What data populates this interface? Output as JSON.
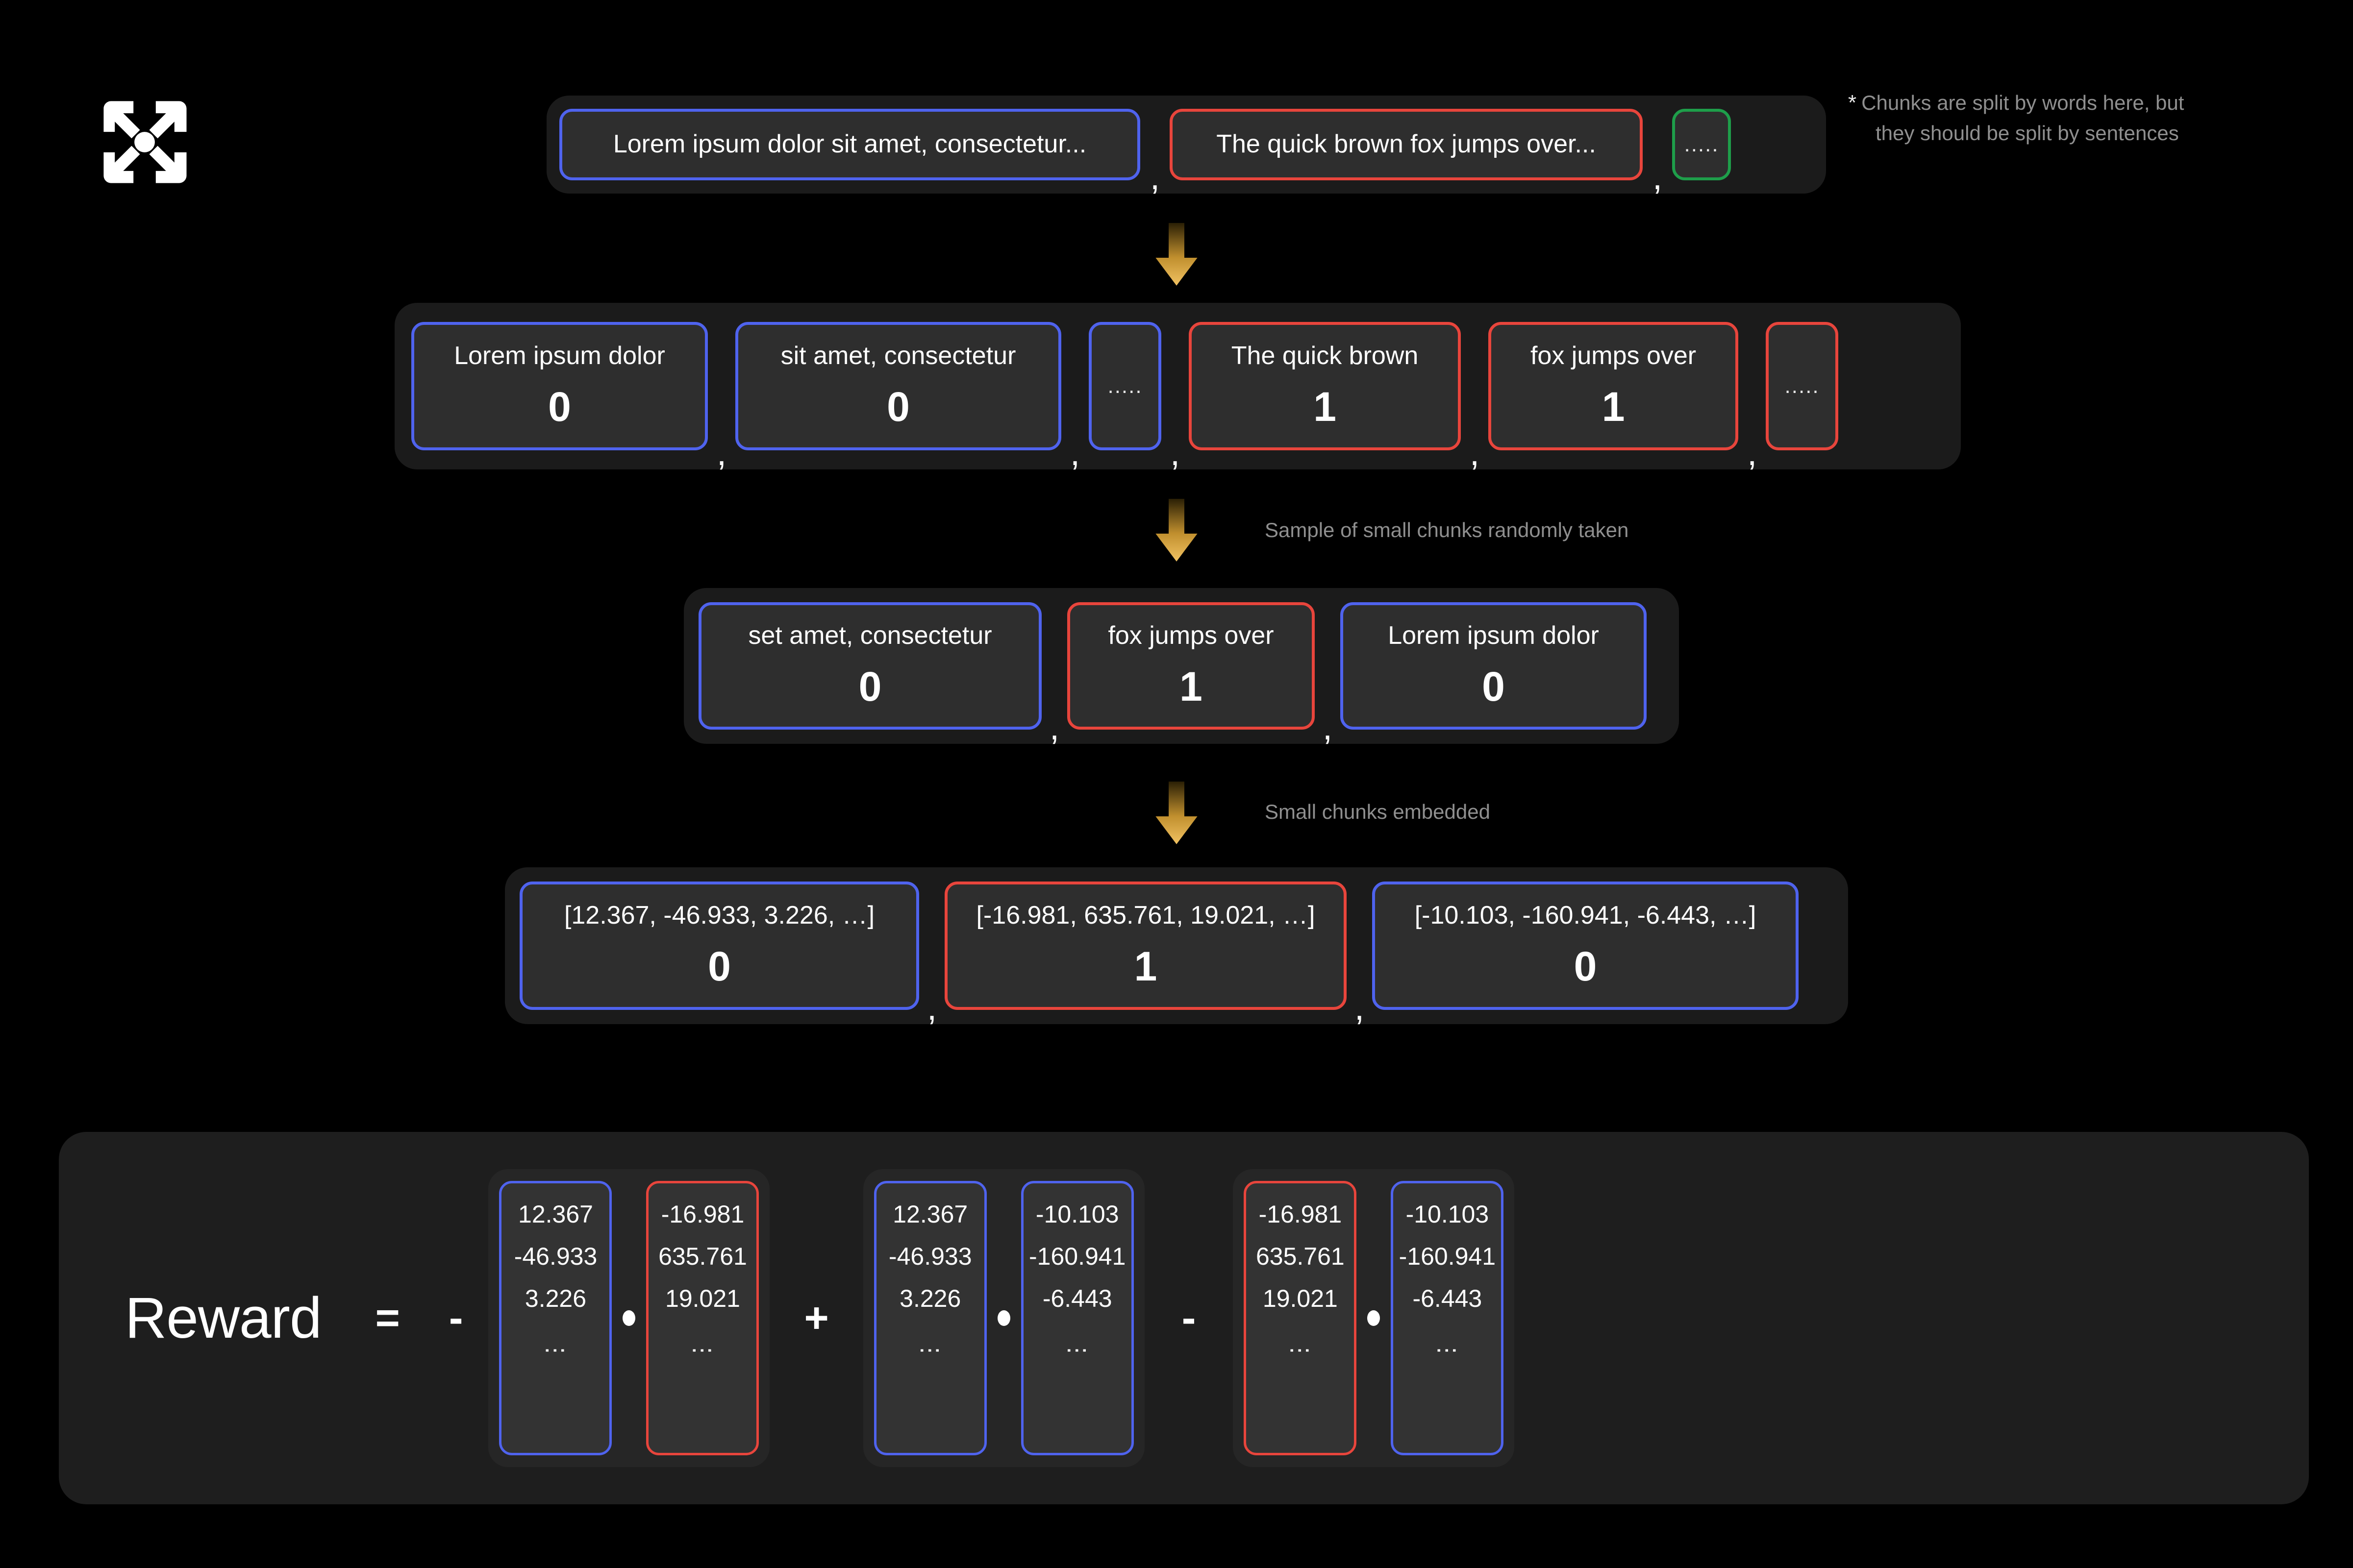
{
  "theme": {
    "background": "#000000",
    "band_bg": "#1b1b1b",
    "card_bg": "#2e2e2e",
    "blue": "#4f63ee",
    "red": "#e8453c",
    "green": "#1e9e4a",
    "arrow_gold": "#e8b44a",
    "muted_text": "#8f8f8f",
    "text": "#ffffff"
  },
  "logo": {
    "icon": "expand-arrows-icon"
  },
  "note": {
    "marker": "*",
    "line1": "Chunks are split by words here, but",
    "line2": "they should be split by sentences"
  },
  "row1": {
    "name": "large-chunks-row",
    "items": [
      {
        "label": "Lorem ipsum dolor sit amet, consectetur...",
        "color": "blue"
      },
      {
        "label": "The quick brown fox jumps over...",
        "color": "red"
      },
      {
        "label": ".....",
        "color": "green"
      }
    ],
    "separator": ","
  },
  "row2": {
    "name": "small-chunks-row",
    "items": [
      {
        "label": "Lorem ipsum dolor",
        "value": "0",
        "color": "blue",
        "narrow": false
      },
      {
        "label": "sit amet, consectetur",
        "value": "0",
        "color": "blue",
        "narrow": false
      },
      {
        "label": ".....",
        "value": "",
        "color": "blue",
        "narrow": true
      },
      {
        "label": "The quick brown",
        "value": "1",
        "color": "red",
        "narrow": false
      },
      {
        "label": "fox jumps over",
        "value": "1",
        "color": "red",
        "narrow": false
      },
      {
        "label": ".....",
        "value": "",
        "color": "red",
        "narrow": true
      }
    ],
    "separator": ","
  },
  "row3": {
    "name": "sampled-chunks-row",
    "caption": "Sample of small chunks randomly taken",
    "items": [
      {
        "label": "set amet, consectetur",
        "value": "0",
        "color": "blue"
      },
      {
        "label": "fox jumps over",
        "value": "1",
        "color": "red"
      },
      {
        "label": "Lorem ipsum dolor",
        "value": "0",
        "color": "blue"
      }
    ],
    "separator": ","
  },
  "row4": {
    "name": "embeddings-row",
    "caption": "Small chunks embedded",
    "items": [
      {
        "label": "[12.367, -46.933, 3.226, …]",
        "value": "0",
        "color": "blue"
      },
      {
        "label": "[-16.981, 635.761, 19.021, …]",
        "value": "1",
        "color": "red"
      },
      {
        "label": "[-10.103, -160.941, -6.443, …]",
        "value": "0",
        "color": "blue"
      }
    ],
    "separator": ","
  },
  "reward": {
    "title": "Reward",
    "equals": "=",
    "sign_first": "-",
    "op_between_1_2": "+",
    "op_between_2_3": "-",
    "dot_symbol": "•",
    "vertical_ellipsis": "⋮",
    "pairs": [
      {
        "left": {
          "color": "blue",
          "values": [
            "12.367",
            "-46.933",
            "3.226"
          ]
        },
        "right": {
          "color": "red",
          "values": [
            "-16.981",
            "635.761",
            "19.021"
          ]
        }
      },
      {
        "left": {
          "color": "blue",
          "values": [
            "12.367",
            "-46.933",
            "3.226"
          ]
        },
        "right": {
          "color": "blue",
          "values": [
            "-10.103",
            "-160.941",
            "-6.443"
          ]
        }
      },
      {
        "left": {
          "color": "red",
          "values": [
            "-16.981",
            "635.761",
            "19.021"
          ]
        },
        "right": {
          "color": "blue",
          "values": [
            "-10.103",
            "-160.941",
            "-6.443"
          ]
        }
      }
    ]
  }
}
